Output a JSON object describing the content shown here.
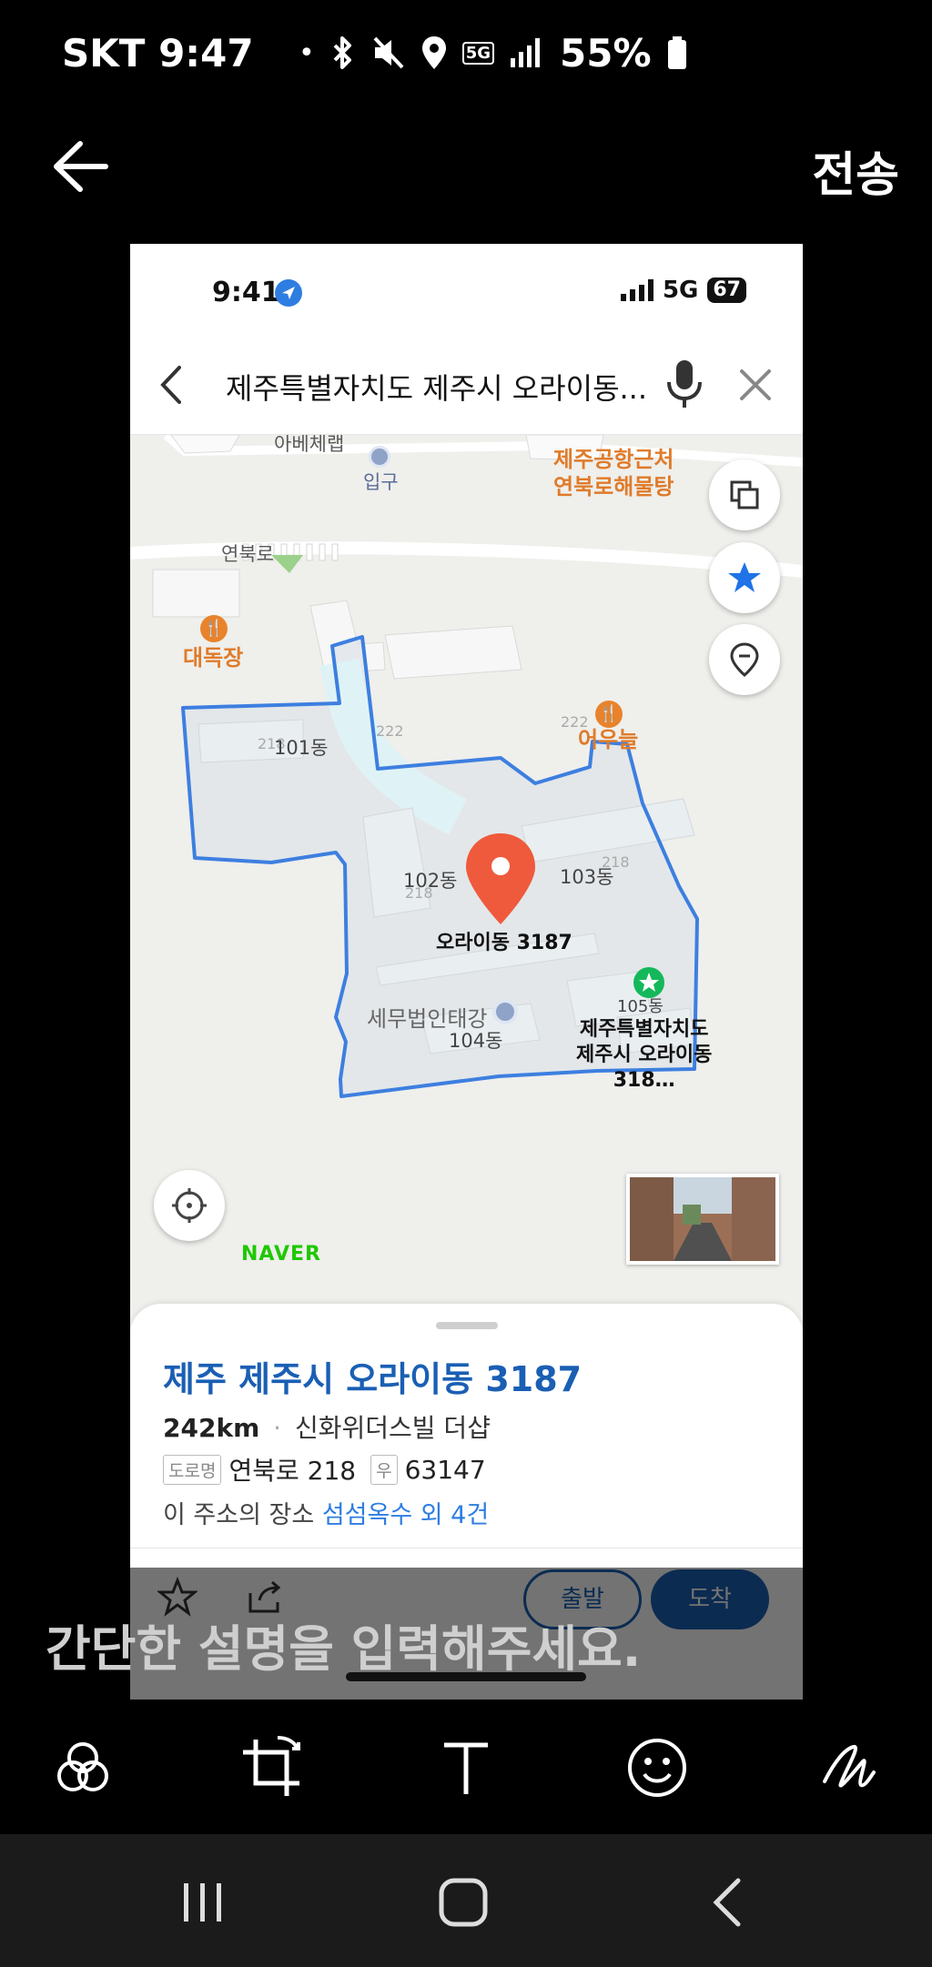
{
  "status_bar": {
    "carrier": "SKT",
    "time": "9:47",
    "dot": "•",
    "network": "5G",
    "battery": "55%"
  },
  "header": {
    "send_label": "전송"
  },
  "screenshot": {
    "ios_time": "9:41",
    "ios_network": "5G",
    "ios_battery": "67",
    "search_text": "제주특별자치도 제주시 오라이동...",
    "map_labels": {
      "abechelab": "아베체랩",
      "entrance": "입구",
      "bath_line1": "제주공항근처",
      "bath_line2": "연북로해물탕",
      "road": "연북로",
      "daedokjang": "대독장",
      "bldg_222a": "222",
      "bldg_222b": "222",
      "eouneul": "어우늘",
      "b101_num": "218",
      "b101": "101동",
      "b102": "102동",
      "b102_num": "218",
      "b103": "103동",
      "b103_num": "218",
      "b104": "104동",
      "b105": "105동",
      "pin_label": "오라이동 3187",
      "tax_office": "세무법인태강",
      "star_line1": "제주특별자치도",
      "star_line2": "제주시 오라이동",
      "star_line3": "318…",
      "naver": "NAVER"
    },
    "sheet": {
      "title": "제주 제주시 오라이동 3187",
      "distance": "242km",
      "sep": "·",
      "building": "신화위더스빌 더샵",
      "road_tag": "도로명",
      "road_addr": "연북로 218",
      "zip_tag": "우",
      "zip": "63147",
      "places_prefix": "이 주소의 장소",
      "places_link": "섬섬옥수 외 4건",
      "start_label": "출발",
      "arrive_label": "도착"
    }
  },
  "caption_placeholder": "간단한 설명을 입력해주세요.",
  "colors": {
    "accent_blue": "#1a5fb4",
    "boundary": "#3d7fe0",
    "pin_red": "#ef5a3c",
    "naver_green": "#1ec800"
  }
}
